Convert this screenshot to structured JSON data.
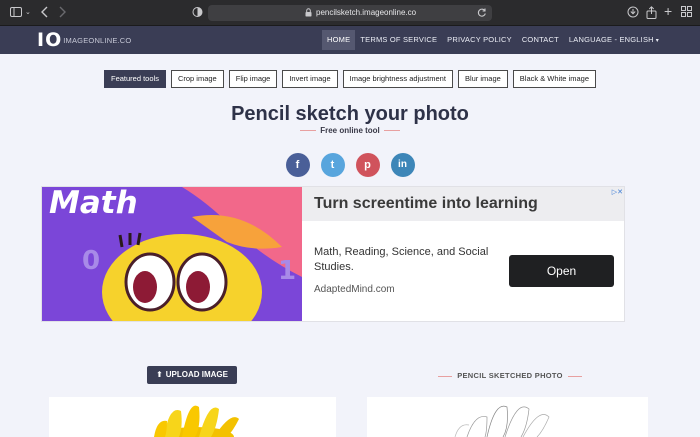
{
  "browser": {
    "url": "pencilsketch.imageonline.co"
  },
  "site": {
    "logo_mark": "IO",
    "logo_text": "IMAGEONLINE.CO",
    "nav": [
      {
        "label": "HOME",
        "active": true
      },
      {
        "label": "TERMS OF SERVICE"
      },
      {
        "label": "PRIVACY POLICY"
      },
      {
        "label": "CONTACT"
      },
      {
        "label": "LANGUAGE - ENGLISH"
      }
    ]
  },
  "tools": [
    "Featured tools",
    "Crop image",
    "Flip image",
    "Invert image",
    "Image brightness adjustment",
    "Blur image",
    "Black & White image"
  ],
  "page": {
    "title": "Pencil sketch your photo",
    "subtitle": "Free online tool"
  },
  "social": [
    {
      "icon": "facebook-icon",
      "glyph": "f",
      "color": "#4a5f98"
    },
    {
      "icon": "twitter-icon",
      "glyph": "t",
      "color": "#58a5dd"
    },
    {
      "icon": "pinterest-icon",
      "glyph": "p",
      "color": "#d0535c"
    },
    {
      "icon": "linkedin-icon",
      "glyph": "in",
      "color": "#3d86b8"
    }
  ],
  "ad": {
    "image_word": "Math",
    "headline": "Turn screentime into learning",
    "body": "Math, Reading, Science, and Social Studies.",
    "domain": "AdaptedMind.com",
    "cta": "Open"
  },
  "main": {
    "upload_label": "UPLOAD IMAGE",
    "sketch_label": "PENCIL SKETCHED PHOTO"
  },
  "colors": {
    "nav_bg": "#3a3d55",
    "page_bg": "#f2f3fa",
    "accent_dash": "#e8a0a0"
  }
}
